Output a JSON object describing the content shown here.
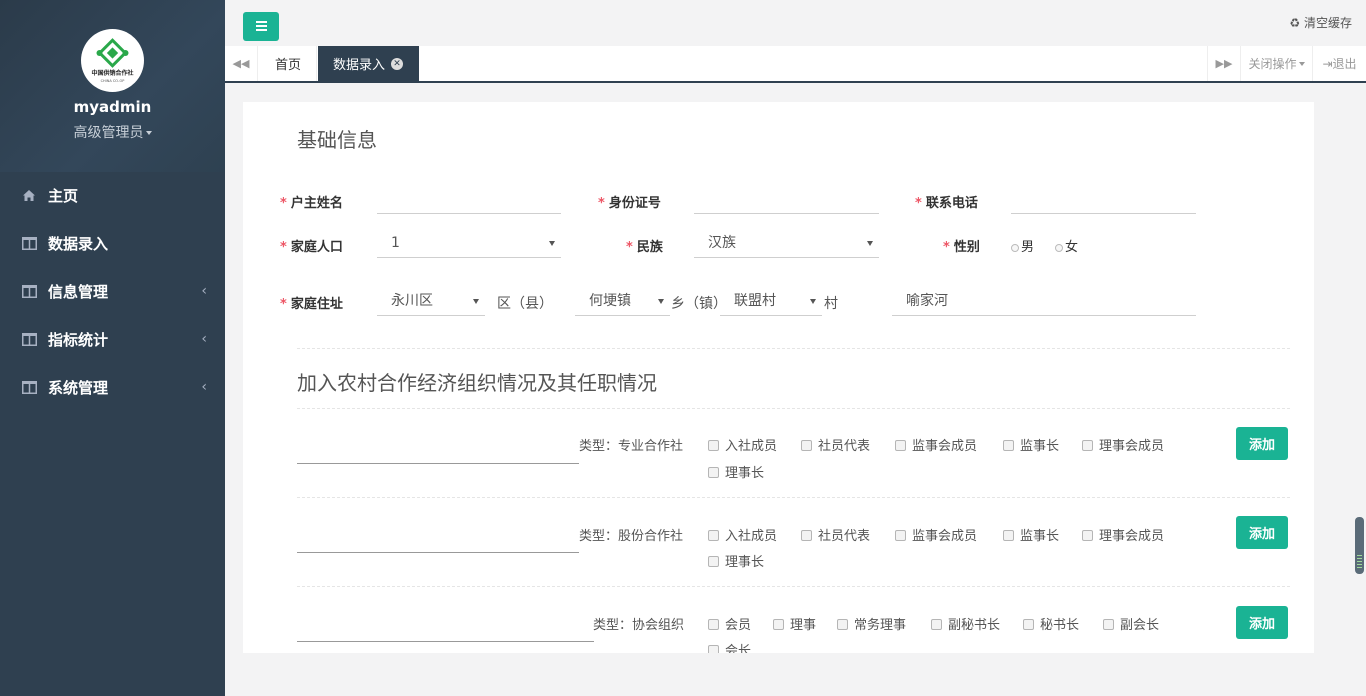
{
  "sidebar": {
    "profile_name": "myadmin",
    "profile_role": "高级管理员",
    "logo_text": "中国供销合作社",
    "logo_subtext": "CHINA CO-OP",
    "items": [
      {
        "label": "主页",
        "icon": "home-icon",
        "has_children": false
      },
      {
        "label": "数据录入",
        "icon": "columns-icon",
        "has_children": false
      },
      {
        "label": "信息管理",
        "icon": "columns-icon",
        "has_children": true
      },
      {
        "label": "指标统计",
        "icon": "columns-icon",
        "has_children": true
      },
      {
        "label": "系统管理",
        "icon": "columns-icon",
        "has_children": true
      }
    ]
  },
  "topbar": {
    "clear_cache": "清空缓存",
    "accent_color": "#1ab394"
  },
  "tabs": {
    "home": "首页",
    "active": "数据录入",
    "close_ops": "关闭操作",
    "logout": "退出"
  },
  "basic": {
    "title": "基础信息",
    "required_mark": "*",
    "head_name_label": "户主姓名",
    "head_name_value": "",
    "id_label": "身份证号",
    "id_value": "",
    "phone_label": "联系电话",
    "phone_value": "",
    "population_label": "家庭人口",
    "population_value": "1",
    "ethnic_label": "民族",
    "ethnic_value": "汉族",
    "gender_label": "性别",
    "gender_male": "男",
    "gender_female": "女",
    "address_label": "家庭住址",
    "district_value": "永川区",
    "district_suffix": "区（县）",
    "town_value": "何埂镇",
    "town_suffix": "乡（镇）",
    "village_value": "联盟村",
    "village_suffix": "村",
    "hamlet_value": "喻家河"
  },
  "orgs": {
    "title": "加入农村合作经济组织情况及其任职情况",
    "add_label": "添加",
    "groups": [
      {
        "type_label": "类型：专业合作社",
        "options": [
          "入社成员",
          "社员代表",
          "监事会成员",
          "监事长",
          "理事会成员",
          "理事长"
        ]
      },
      {
        "type_label": "类型：股份合作社",
        "options": [
          "入社成员",
          "社员代表",
          "监事会成员",
          "监事长",
          "理事会成员",
          "理事长"
        ]
      },
      {
        "type_label": "类型：协会组织",
        "options": [
          "会员",
          "理事",
          "常务理事",
          "副秘书长",
          "秘书长",
          "副会长",
          "会长"
        ]
      }
    ]
  }
}
